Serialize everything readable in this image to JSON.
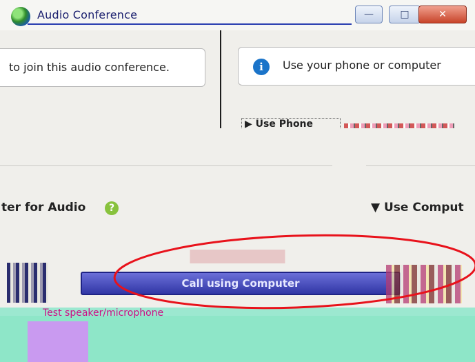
{
  "window": {
    "title": "Audio Conference",
    "minimize_label": "—",
    "maximize_label": "□",
    "close_label": "✕"
  },
  "left_panel": {
    "message": "to join this audio conference."
  },
  "right_panel": {
    "info_icon_glyph": "i",
    "message": "Use your phone or computer",
    "use_phone_label": "▶ Use Phone"
  },
  "audio_section": {
    "label": "ter for Audio",
    "help_icon_glyph": "?",
    "use_computer_label": "Use Comput",
    "use_computer_arrow": "▼"
  },
  "call_section": {
    "call_button_label": "Call using Computer",
    "test_link_label": "Test speaker/microphone"
  },
  "colors": {
    "annotation_ellipse": "#e8121b",
    "call_button": "#3b40b0",
    "info_icon": "#1b74c9",
    "help_icon": "#88c23d"
  },
  "icons": [
    "globe-icon",
    "info-icon",
    "help-icon",
    "headset-icon"
  ]
}
